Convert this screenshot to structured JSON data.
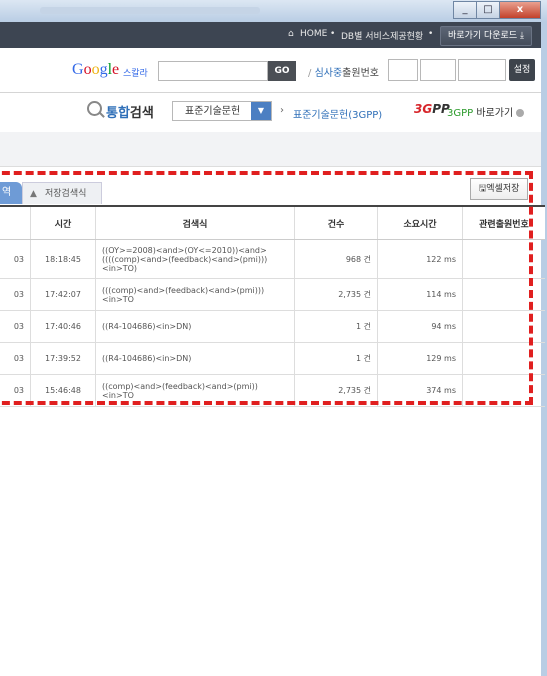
{
  "window": {
    "min": "_",
    "max": "□",
    "close": "x"
  },
  "topnav": {
    "home": "HOME",
    "service": "DB별 서비스제공현황",
    "download": "바로가기 다운로드"
  },
  "search": {
    "google": "Google",
    "scholar": "스칼라",
    "go": "GO",
    "label_blue": "심사중",
    "label_rest": "출원번호",
    "set": "설정"
  },
  "crumb": {
    "title_blue": "통합",
    "title_rest": "검색",
    "select": "표준기술문헌",
    "current": "표준기술문헌(3GPP)",
    "logo": "3GPP",
    "go3gpp_green": "3GPP",
    "go3gpp_rest": "바로가기"
  },
  "tabs": {
    "active": "역",
    "saved": "저장검색식",
    "excel": "엑셀저장"
  },
  "table": {
    "headers": [
      "시간",
      "검색식",
      "건수",
      "소요시간",
      "관련출원번호"
    ],
    "rows": [
      {
        "date": "03",
        "time": "18:18:45",
        "query": "((OY>=2008)<and>(OY<=2010))<and>((((comp)<and>(feedback)<and>(pmi)))<in>TO)",
        "count": "968 건",
        "dur": "122 ms",
        "rel": ""
      },
      {
        "date": "03",
        "time": "17:42:07",
        "query": "(((comp)<and>(feedback)<and>(pmi)))<in>TO",
        "count": "2,735 건",
        "dur": "114 ms",
        "rel": ""
      },
      {
        "date": "03",
        "time": "17:40:46",
        "query": "((R4-104686)<in>DN)",
        "count": "1 건",
        "dur": "94 ms",
        "rel": ""
      },
      {
        "date": "03",
        "time": "17:39:52",
        "query": "((R4-104686)<in>DN)",
        "count": "1 건",
        "dur": "129 ms",
        "rel": ""
      },
      {
        "date": "03",
        "time": "15:46:48",
        "query": "((comp)<and>(feedback)<and>(pmi))<in>TO",
        "count": "2,735 건",
        "dur": "374 ms",
        "rel": ""
      }
    ]
  }
}
